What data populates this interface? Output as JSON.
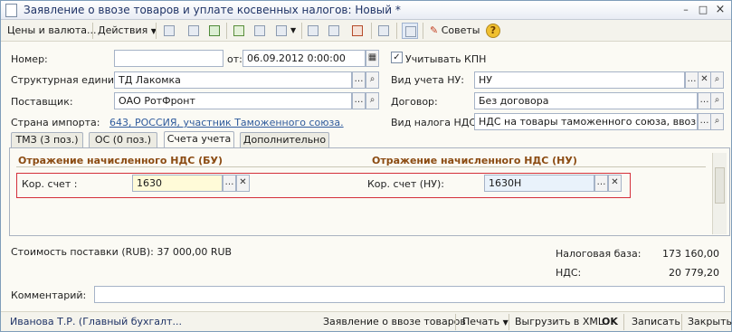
{
  "window": {
    "title": "Заявление о ввозе товаров и уплате косвенных налогов: Новый *",
    "minimize": "–",
    "maximize": "□",
    "close": "×"
  },
  "toolbar": {
    "prices": "Цены и валюта...",
    "actions": "Действия",
    "advice": "Советы",
    "help": "?"
  },
  "form": {
    "number_label": "Номер:",
    "number_value": "",
    "date_label": "от:",
    "date_value": "06.09.2012  0:00:00",
    "kpn_label": "Учитывать КПН",
    "kpn_checked": true,
    "unit_label": "Структурная единица:",
    "unit_value": "ТД Лакомка",
    "nu_type_label": "Вид учета НУ:",
    "nu_type_value": "НУ",
    "supplier_label": "Поставщик:",
    "supplier_value": "ОАО РотФронт",
    "contract_label": "Договор:",
    "contract_value": "Без договора",
    "country_label": "Страна импорта:",
    "country_value": "643, РОССИЯ, участник Таможенного союза.",
    "vat_type_label": "Вид налога НДС:",
    "vat_type_value": "НДС на товары таможенного союза, ввозимые"
  },
  "tabs": [
    {
      "label": "ТМЗ (3 поз.)"
    },
    {
      "label": "ОС (0 поз.)"
    },
    {
      "label": "Счета учета"
    },
    {
      "label": "Дополнительно"
    }
  ],
  "accounts": {
    "bu_header": "Отражение начисленного НДС (БУ)",
    "nu_header": "Отражение начисленного НДС (НУ)",
    "bu_label": "Кор. счет :",
    "bu_value": "1630",
    "nu_label": "Кор. счет (НУ):",
    "nu_value": "1630Н"
  },
  "totals": {
    "cost": "Стоимость поставки (RUB): 37 000,00 RUB",
    "tax_base_label": "Налоговая база:",
    "tax_base_value": "173 160,00",
    "vat_label": "НДС:",
    "vat_value": "20 779,20"
  },
  "comment": {
    "label": "Комментарий:",
    "value": ""
  },
  "footer": {
    "user": "Иванова Т.Р. (Главный бухгалт...",
    "statement": "Заявление о ввозе товаров",
    "print": "Печать",
    "export": "Выгрузить в XML",
    "ok": "OK",
    "save": "Записать",
    "close": "Закрыть"
  },
  "colors": {
    "accent": "#2e5a9c",
    "section": "#8b4b12",
    "highlight": "#d4303a"
  }
}
